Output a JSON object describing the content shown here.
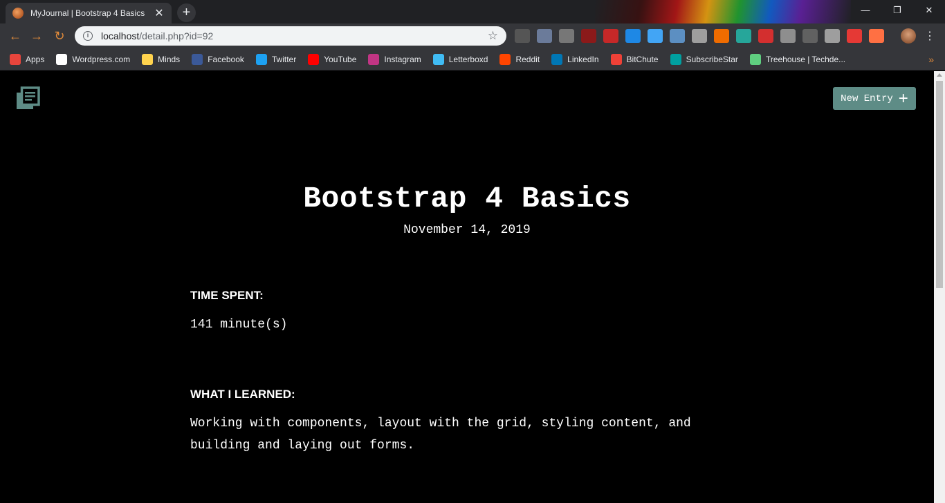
{
  "browser": {
    "tab_title": "MyJournal | Bootstrap 4 Basics",
    "tab_close": "✕",
    "new_tab": "+",
    "url_host": "localhost",
    "url_path": "/detail.php?id=92",
    "window_controls": {
      "minimize": "—",
      "restore": "❐",
      "close": "✕"
    },
    "bookmarks": [
      {
        "label": "Apps",
        "icon": "apps-grid-icon",
        "color": "#e8453c"
      },
      {
        "label": "Wordpress.com",
        "icon": "wordpress-icon",
        "color": "#ffffff"
      },
      {
        "label": "Minds",
        "icon": "lightbulb-icon",
        "color": "#ffd34e"
      },
      {
        "label": "Facebook",
        "icon": "facebook-icon",
        "color": "#3b5998"
      },
      {
        "label": "Twitter",
        "icon": "twitter-icon",
        "color": "#1da1f2"
      },
      {
        "label": "YouTube",
        "icon": "youtube-icon",
        "color": "#ff0000"
      },
      {
        "label": "Instagram",
        "icon": "instagram-icon",
        "color": "#c13584"
      },
      {
        "label": "Letterboxd",
        "icon": "letterboxd-icon",
        "color": "#40bcf4"
      },
      {
        "label": "Reddit",
        "icon": "reddit-icon",
        "color": "#ff4500"
      },
      {
        "label": "LinkedIn",
        "icon": "linkedin-icon",
        "color": "#0077b5"
      },
      {
        "label": "BitChute",
        "icon": "bitchute-icon",
        "color": "#ef4137"
      },
      {
        "label": "SubscribeStar",
        "icon": "subscribestar-icon",
        "color": "#00a0a0"
      },
      {
        "label": "Treehouse | Techde...",
        "icon": "treehouse-icon",
        "color": "#5fcf80"
      }
    ],
    "bookmarks_more": "»"
  },
  "page": {
    "new_entry_label": "New Entry",
    "entry": {
      "title": "Bootstrap 4 Basics",
      "date": "November 14, 2019",
      "time_spent_label": "TIME SPENT:",
      "time_spent_value": "141 minute(s)",
      "learned_label": "WHAT I LEARNED:",
      "learned_value": "Working with components, layout with the grid, styling content, and building and laying out forms."
    }
  },
  "colors": {
    "accent": "#5e8c86",
    "page_bg": "#000000",
    "text": "#ffffff"
  }
}
